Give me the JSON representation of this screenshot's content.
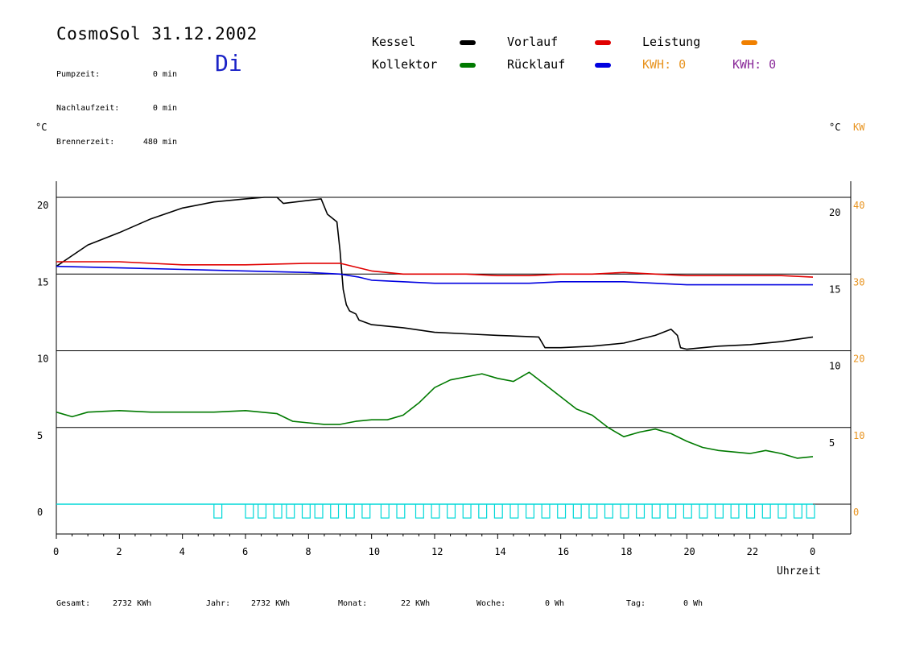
{
  "header": {
    "title": "CosmoSol 31.12.2002",
    "day": "Di",
    "stats": [
      {
        "label": "Pumpzeit:",
        "value": "0 min"
      },
      {
        "label": "Nachlaufzeit:",
        "value": "0 min"
      },
      {
        "label": "Brennerzeit:",
        "value": "480 min"
      }
    ]
  },
  "legend": {
    "items": [
      {
        "label": "Kessel",
        "color": "#000000"
      },
      {
        "label": "Vorlauf",
        "color": "#e00000"
      },
      {
        "label": "Leistung",
        "color": "#f08000"
      },
      {
        "label": "Kollektor",
        "color": "#007a00"
      },
      {
        "label": "Rücklauf",
        "color": "#0000e0"
      }
    ],
    "kwh_orange": "KWH: 0",
    "kwh_purple": "KWH: 0"
  },
  "axes": {
    "left_unit": "°C",
    "right_unit_c": "°C",
    "right_unit_kw": "KW",
    "xlabel": "Uhrzeit"
  },
  "footer": [
    {
      "label": "Gesamt:",
      "value": "2732 KWh"
    },
    {
      "label": "Jahr:",
      "value": "2732 KWh"
    },
    {
      "label": "Monat:",
      "value": "22 KWh"
    },
    {
      "label": "Woche:",
      "value": "0 Wh"
    },
    {
      "label": "Tag:",
      "value": "0 Wh"
    }
  ],
  "chart_data": {
    "type": "line",
    "xlabel": "Uhrzeit",
    "x_ticks": [
      "0",
      "2",
      "4",
      "6",
      "8",
      "10",
      "12",
      "14",
      "16",
      "18",
      "20",
      "22",
      "0"
    ],
    "left_ticks": [
      "20",
      "15",
      "10",
      "5",
      "0"
    ],
    "right_ticks_upper": [
      "20",
      "15"
    ],
    "right_ticks_lower": [
      "10",
      "5"
    ],
    "right_ticks_kw": [
      "40",
      "30",
      "20",
      "10",
      "0"
    ],
    "xlim": [
      0,
      24
    ],
    "ylim": [
      -1.5,
      21
    ],
    "series": [
      {
        "name": "Kessel",
        "color": "#000000",
        "x": [
          0,
          0.5,
          1,
          2,
          3,
          4,
          5,
          6,
          6.6,
          7.0,
          7.2,
          8.0,
          8.4,
          8.6,
          8.9,
          9.0,
          9.1,
          9.2,
          9.3,
          9.5,
          9.6,
          10,
          11,
          12,
          13,
          14,
          15.3,
          15.5,
          16,
          17,
          18,
          19,
          19.5,
          19.7,
          19.8,
          20,
          21,
          22,
          23,
          24
        ],
        "y": [
          15.5,
          16.2,
          16.9,
          17.7,
          18.6,
          19.3,
          19.7,
          19.9,
          20.0,
          20.0,
          19.6,
          19.8,
          19.9,
          18.9,
          18.4,
          16.5,
          14.0,
          13.0,
          12.6,
          12.4,
          12.0,
          11.7,
          11.5,
          11.2,
          11.1,
          11.0,
          10.9,
          10.2,
          10.2,
          10.3,
          10.5,
          11.0,
          11.4,
          11.0,
          10.2,
          10.1,
          10.3,
          10.4,
          10.6,
          10.9
        ]
      },
      {
        "name": "Vorlauf",
        "color": "#e00000",
        "x": [
          0,
          2,
          4,
          6,
          8,
          9,
          10,
          11,
          12,
          13,
          14,
          15,
          16,
          17,
          18,
          19,
          20,
          21,
          22,
          23,
          24
        ],
        "y": [
          15.8,
          15.8,
          15.6,
          15.6,
          15.7,
          15.7,
          15.2,
          15.0,
          15.0,
          15.0,
          14.9,
          14.9,
          15.0,
          15.0,
          15.1,
          15.0,
          14.9,
          14.9,
          14.9,
          14.9,
          14.8
        ]
      },
      {
        "name": "Rücklauf",
        "color": "#0000e0",
        "x": [
          0,
          2,
          4,
          6,
          8,
          9,
          9.6,
          10,
          11,
          12,
          13,
          14,
          15,
          16,
          17,
          18,
          19,
          20,
          21,
          22,
          23,
          24
        ],
        "y": [
          15.5,
          15.4,
          15.3,
          15.2,
          15.1,
          15.0,
          14.8,
          14.6,
          14.5,
          14.4,
          14.4,
          14.4,
          14.4,
          14.5,
          14.5,
          14.5,
          14.4,
          14.3,
          14.3,
          14.3,
          14.3,
          14.3
        ]
      },
      {
        "name": "Kollektor",
        "color": "#007a00",
        "x": [
          0,
          0.5,
          1,
          2,
          3,
          4,
          5,
          6,
          7,
          7.5,
          8,
          8.5,
          9,
          9.5,
          10,
          10.5,
          11,
          11.5,
          12,
          12.5,
          13,
          13.5,
          14,
          14.5,
          15,
          15.5,
          16,
          16.5,
          17,
          17.5,
          18,
          18.5,
          19,
          19.5,
          20,
          20.5,
          21,
          21.5,
          22,
          22.5,
          23,
          23.5,
          24
        ],
        "y": [
          6.0,
          5.7,
          6.0,
          6.1,
          6.0,
          6.0,
          6.0,
          6.1,
          5.9,
          5.4,
          5.3,
          5.2,
          5.2,
          5.4,
          5.5,
          5.5,
          5.8,
          6.6,
          7.6,
          8.1,
          8.3,
          8.5,
          8.2,
          8.0,
          8.6,
          7.8,
          7.0,
          6.2,
          5.8,
          5.0,
          4.4,
          4.7,
          4.9,
          4.6,
          4.1,
          3.7,
          3.5,
          3.4,
          3.3,
          3.5,
          3.3,
          3.0,
          3.1
        ]
      },
      {
        "name": "Leistung",
        "color": "#00d8d8",
        "pulses_x": [
          5,
          6,
          6.4,
          6.9,
          7.3,
          7.8,
          8.2,
          8.7,
          9.2,
          9.7,
          10.3,
          10.8,
          11.4,
          11.9,
          12.4,
          12.9,
          13.4,
          13.9,
          14.4,
          14.9,
          15.4,
          15.9,
          16.4,
          16.9,
          17.4,
          17.9,
          18.4,
          18.9,
          19.4,
          19.9,
          20.4,
          20.9,
          21.4,
          21.9,
          22.4,
          22.9,
          23.4,
          23.8
        ],
        "pulse_width": 0.25,
        "y": 0
      }
    ]
  }
}
